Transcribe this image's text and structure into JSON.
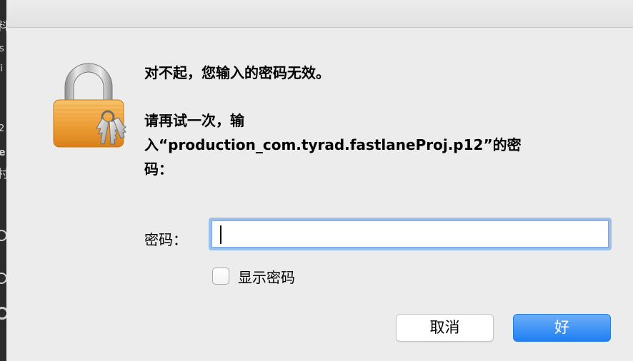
{
  "background": {
    "glyphs": [
      "料",
      "s",
      "/i",
      "2",
      "e",
      "村"
    ]
  },
  "dialog": {
    "title": "对不起，您输入的密码无效。",
    "body_lines": [
      "请再试一次，输",
      "入“production_com.tyrad.fastlaneProj.p12”的密",
      "码："
    ],
    "password_label": "密码：",
    "password_value": "",
    "show_password_label": "显示密码",
    "show_password_checked": false,
    "cancel_label": "取消",
    "ok_label": "好"
  },
  "colors": {
    "accent": "#1f7ff3",
    "focus_ring": "#9cc0ee",
    "lock_body": "#f0a23a"
  },
  "icons": {
    "lock": "padlock-with-keys-icon"
  }
}
